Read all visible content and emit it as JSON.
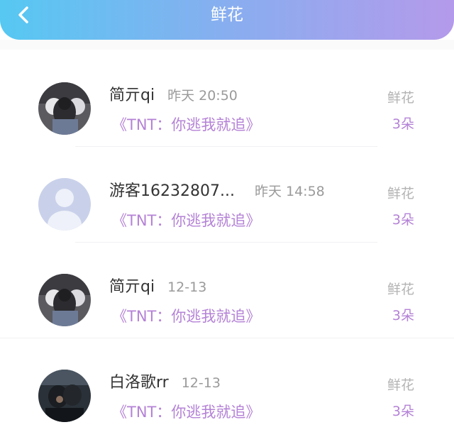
{
  "header": {
    "title": "鲜花",
    "back_icon": "chevron-left-icon",
    "gradient": [
      "#56c8f2",
      "#b49aea"
    ]
  },
  "colors": {
    "accent": "#b482d6",
    "name": "#333333",
    "time": "#9a9a9a",
    "gift_label": "#b3b3b3"
  },
  "items": [
    {
      "avatar": "photo-avatar-icon",
      "name": "简亓qi",
      "time": "昨天 20:50",
      "book": "《TNT：你逃我就追》",
      "gift_label": "鲜花",
      "gift_count": "3朵"
    },
    {
      "avatar": "default-user-avatar-icon",
      "name": "游客16232807...",
      "time": "昨天 14:58",
      "book": "《TNT：你逃我就追》",
      "gift_label": "鲜花",
      "gift_count": "3朵"
    },
    {
      "avatar": "photo-avatar-icon",
      "name": "简亓qi",
      "time": "12-13",
      "book": "《TNT：你逃我就追》",
      "gift_label": "鲜花",
      "gift_count": "3朵"
    },
    {
      "avatar": "photo-avatar-icon",
      "name": "白洛歌rr",
      "time": "12-13",
      "book": "《TNT：你逃我就追》",
      "gift_label": "鲜花",
      "gift_count": "3朵"
    }
  ]
}
